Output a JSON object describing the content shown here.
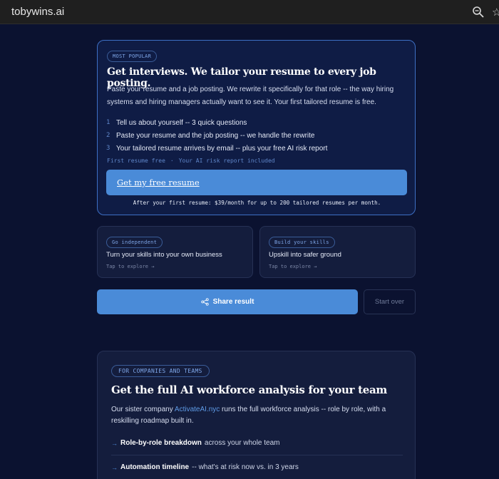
{
  "browser": {
    "site_name": "tobywins.ai",
    "icons": [
      "site-settings-icon",
      "zoom-icon",
      "star-icon"
    ]
  },
  "promo": {
    "badge": "MOST POPULAR",
    "title": "Get interviews. We tailor your resume to every job posting.",
    "description": "Paste your resume and a job posting. We rewrite it specifically for that role -- the way hiring systems and hiring managers actually want to see it. Your first tailored resume is free.",
    "steps": [
      {
        "num": "1",
        "text": "Tell us about yourself -- 3 quick questions"
      },
      {
        "num": "2",
        "text": "Paste your resume and the job posting -- we handle the rewrite"
      },
      {
        "num": "3",
        "text": "Your tailored resume arrives by email -- plus your free AI risk report"
      }
    ],
    "free_note_1": "First resume free",
    "free_note_sep": "·",
    "free_note_2": "Your AI risk report included",
    "cta_label": "Get my free resume",
    "after_note": "After your first resume: $39/month for up to 200 tailored resumes per month."
  },
  "cards": [
    {
      "badge": "Go independent",
      "title": "Turn your skills into your own business",
      "sub": "Tap to explore →"
    },
    {
      "badge": "Build your skills",
      "title": "Upskill into safer ground",
      "sub": "Tap to explore →"
    }
  ],
  "actions": {
    "share_label": "Share result",
    "start_over_label": "Start over"
  },
  "company": {
    "badge": "FOR COMPANIES AND TEAMS",
    "title": "Get the full AI workforce analysis for your team",
    "desc_prefix": "Our sister company ",
    "desc_link": "ActivateAI.nyc",
    "desc_suffix": " runs the full workforce analysis -- role by role, with a reskilling roadmap built in.",
    "features": [
      {
        "bold": "Role-by-role breakdown",
        "rest": "across your whole team"
      },
      {
        "bold": "Automation timeline",
        "rest": "-- what's at risk now vs. in 3 years"
      }
    ]
  },
  "colors": {
    "background": "#0b1230",
    "accent": "#4a8bd8",
    "card_border_highlight": "#3d6fc4"
  }
}
